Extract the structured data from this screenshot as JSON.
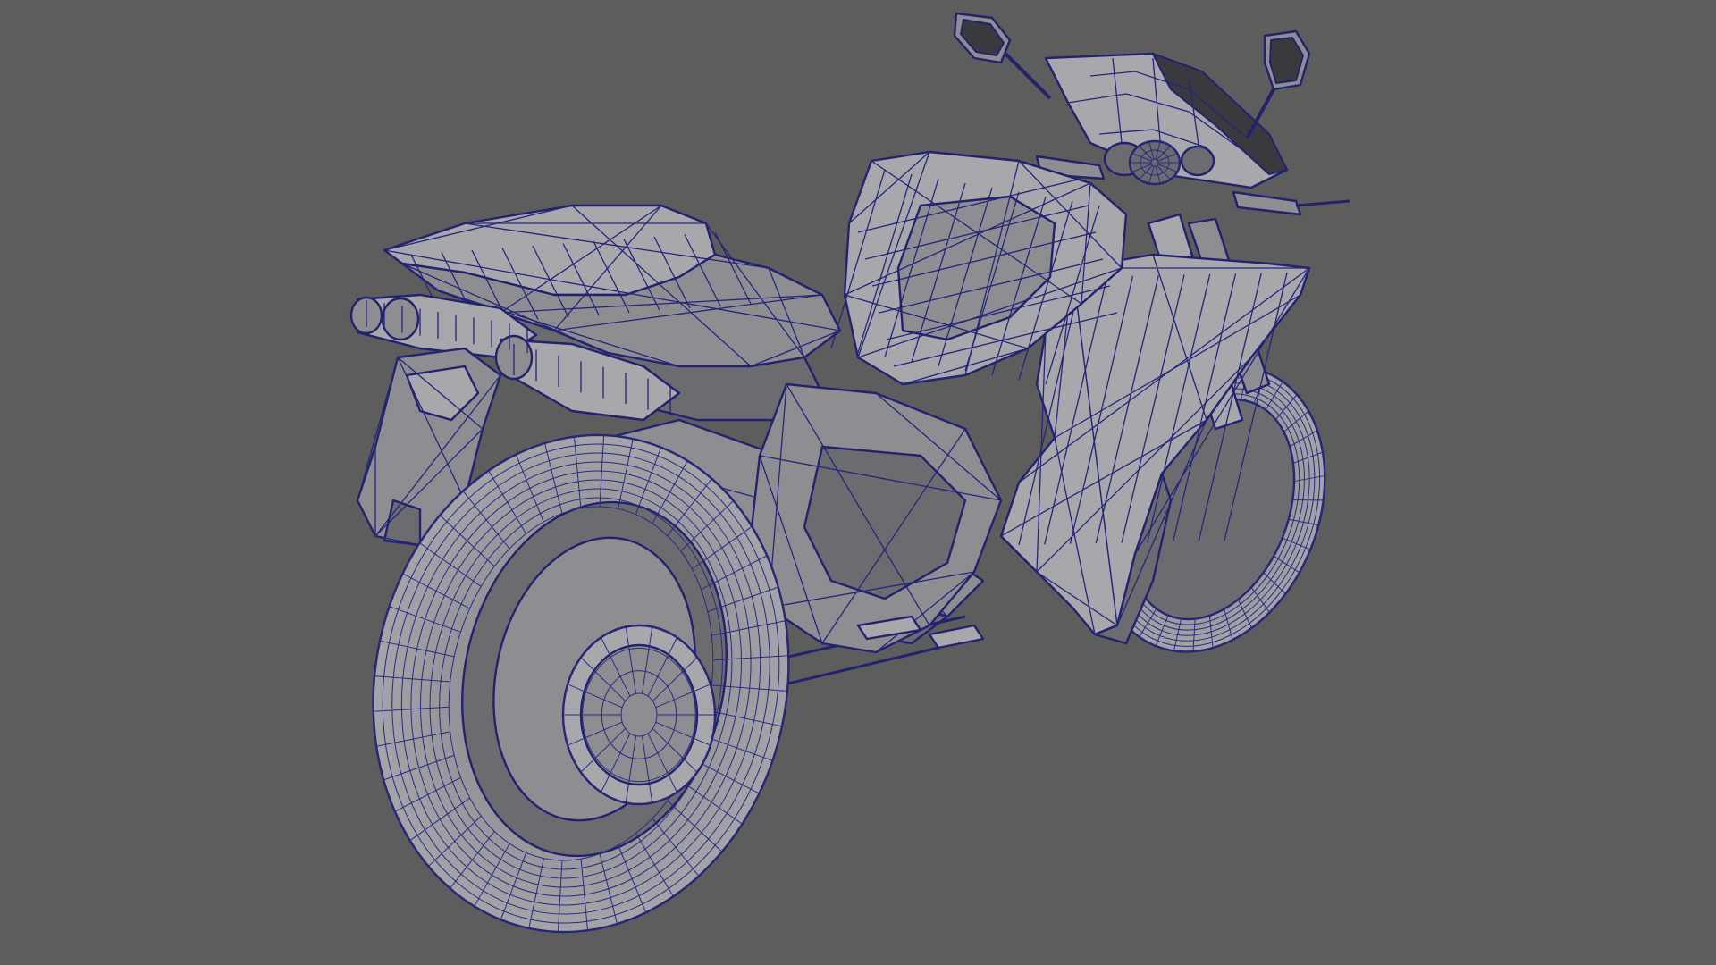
{
  "viewport": {
    "background_color": "#5d5d5d",
    "mesh_fill_color": "#8e8e92",
    "wireframe_color": "#22226e",
    "shading_mode": "wireframe-on-shaded",
    "object": "motorcycle"
  }
}
